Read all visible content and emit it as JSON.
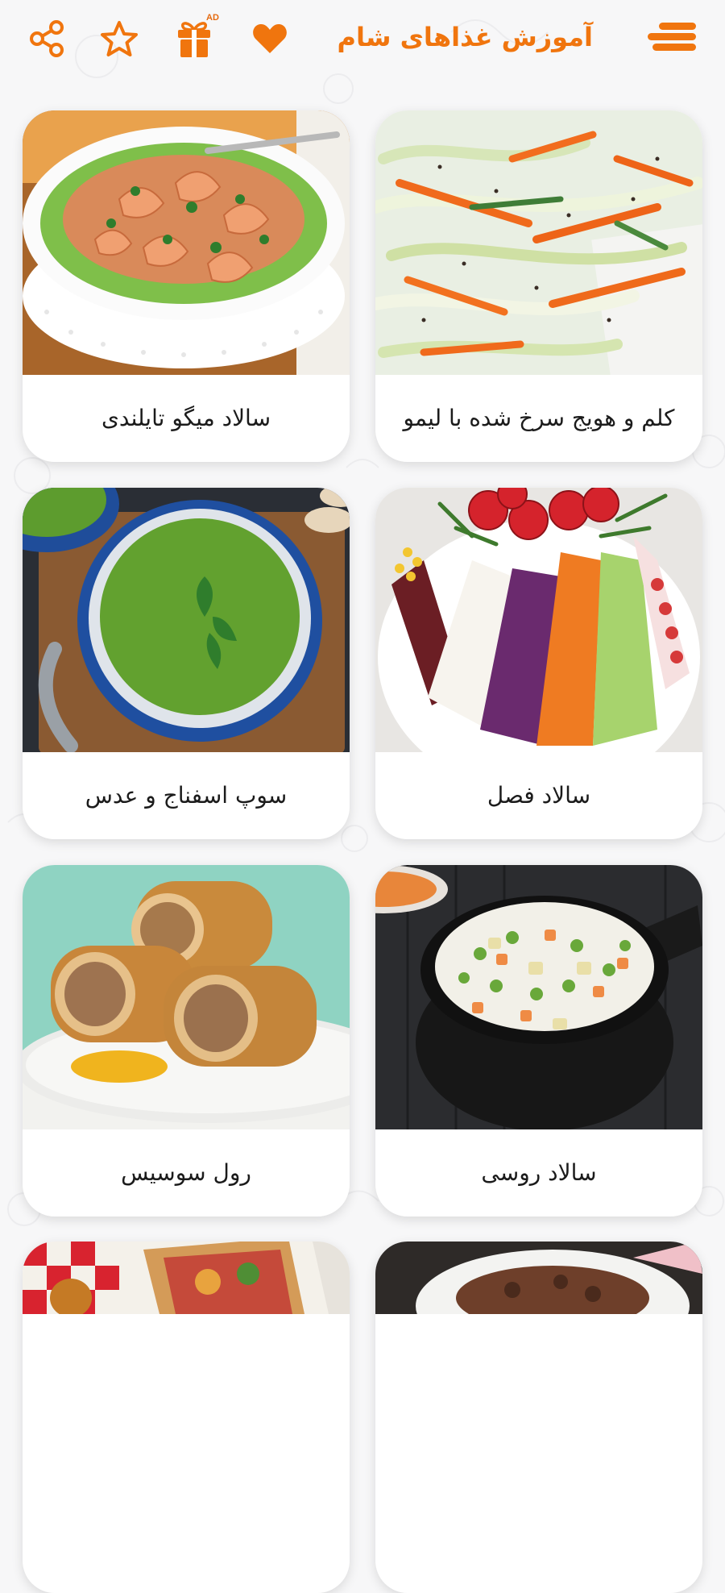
{
  "app_bar": {
    "title": "آموزش غذاهای شام",
    "ad_badge": "AD",
    "icons": {
      "menu": "menu-icon",
      "favorite": "heart-icon",
      "gift": "gift-icon",
      "rate": "star-icon",
      "share": "share-icon"
    },
    "accent_color": "#f0750e"
  },
  "cards": [
    {
      "title": "کلم و هویج سرخ شده با لیمو",
      "image": "cabbage-carrot-slaw-image"
    },
    {
      "title": "سالاد میگو تایلندی",
      "image": "thai-shrimp-salad-image"
    },
    {
      "title": "سالاد فصل",
      "image": "seasonal-salad-image"
    },
    {
      "title": "سوپ اسفناج و عدس",
      "image": "spinach-lentil-soup-image"
    },
    {
      "title": "سالاد روسی",
      "image": "russian-salad-image"
    },
    {
      "title": "رول سوسیس",
      "image": "sausage-roll-image"
    },
    {
      "title": "",
      "image": "partial-meat-dish-image"
    },
    {
      "title": "",
      "image": "partial-tart-image"
    }
  ]
}
